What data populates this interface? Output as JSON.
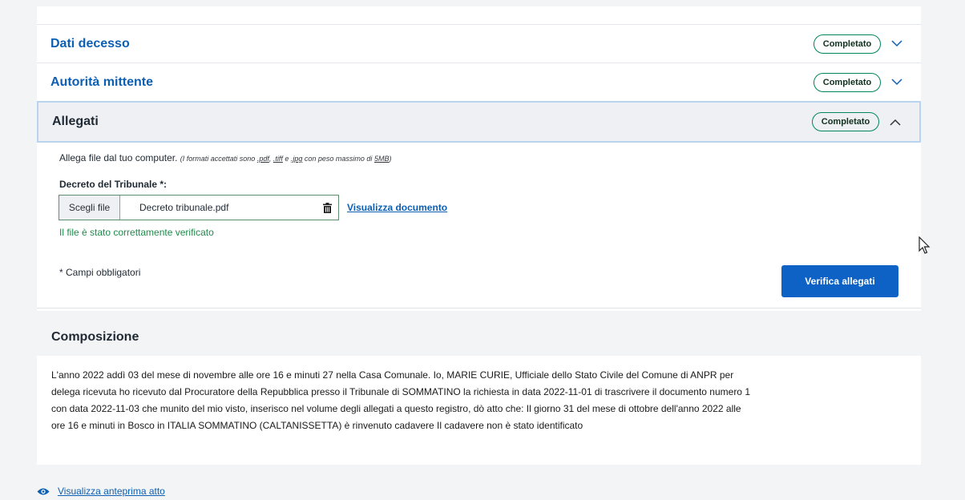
{
  "accordion": {
    "items": [
      {
        "title": "Dati decesso",
        "status": "Completato",
        "expanded": false
      },
      {
        "title": "Autorità mittente",
        "status": "Completato",
        "expanded": false
      },
      {
        "title": "Allegati",
        "status": "Completato",
        "expanded": true
      }
    ]
  },
  "allegati": {
    "hint_main": "Allega file dal tuo computer.",
    "hint_italic_a": "(I formati accettati sono ",
    "hint_pdf": ".pdf",
    "hint_comma": ", ",
    "hint_tiff": ".tiff",
    "hint_e": " e ",
    "hint_jpg": ".jpg",
    "hint_tail": " con peso massimo di ",
    "hint_size": "5MB",
    "hint_close": ")",
    "field_label": "Decreto del Tribunale *:",
    "choose_label": "Scegli file",
    "file_name": "Decreto tribunale.pdf",
    "view_link": "Visualizza documento",
    "ok_message": "Il file è stato correttamente verificato",
    "required_note": "* Campi obbligatori",
    "verify_button": "Verifica allegati"
  },
  "composizione": {
    "title": "Composizione",
    "text": "L'anno 2022 addì 03 del mese di novembre alle ore 16 e minuti 27 nella Casa Comunale. Io, MARIE CURIE, Ufficiale dello Stato Civile del Comune di ANPR per delega ricevuta ho ricevuto dal Procuratore della Repubblica presso il Tribunale di SOMMATINO la richiesta in data 2022-11-01 di trascrivere il documento numero 1 con data 2022-11-03 che munito del mio visto, inserisco nel volume degli allegati a questo registro, dò atto che: Il giorno 31 del mese di ottobre dell'anno 2022 alle ore 16 e minuti in Bosco in ITALIA SOMMATINO (CALTANISSETTA) è rinvenuto cadavere Il cadavere non è stato identificato"
  },
  "preview_link": "Visualizza anteprima atto",
  "colors": {
    "link": "#0d5fb3",
    "primary": "#0e62c6",
    "success": "#008758"
  },
  "icons": [
    "chevron-down-icon",
    "chevron-up-icon",
    "trash-icon",
    "eye-icon",
    "mouse-cursor-icon"
  ]
}
